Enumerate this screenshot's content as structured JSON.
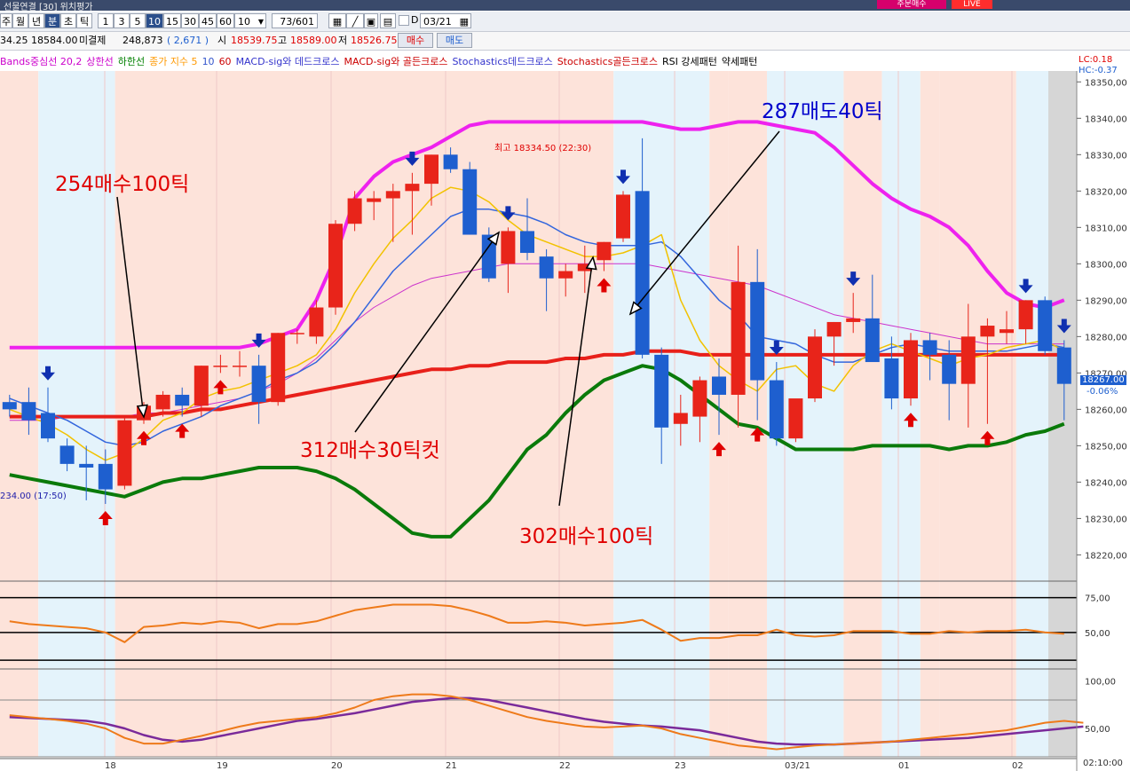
{
  "window": {
    "title_fragment": "선물연결 [30] 위치평가",
    "right_button": "주문매수",
    "live_badge": "LIVE"
  },
  "toolbar": {
    "period_buttons": [
      "주",
      "월",
      "년",
      "분",
      "초",
      "틱"
    ],
    "interval_buttons": [
      "1",
      "3",
      "5",
      "10",
      "15",
      "30",
      "45",
      "60"
    ],
    "selected_interval": "10",
    "count_value": "10",
    "page_indicator": "73/601",
    "d_label": "D",
    "date_value": "03/21"
  },
  "quote": {
    "prev": "34.25",
    "last": "18584.00",
    "open_interest_label": "미결제",
    "open_interest": "248,873",
    "oi_change": "( 2,671 )",
    "open_label": "시",
    "open": "18539.75",
    "high_label": "고",
    "high": "18589.00",
    "low_label": "저",
    "low": "18526.75",
    "buy_button": "매수",
    "sell_button": "매도"
  },
  "legend": [
    {
      "text": "Bands중심선 20,2",
      "color": "#cc00cc"
    },
    {
      "text": "상한선",
      "color": "#cc00cc"
    },
    {
      "text": "하한선",
      "color": "#008000"
    },
    {
      "text": "종가 지수 5",
      "color": "#ff9900"
    },
    {
      "text": "10",
      "color": "#3355cc"
    },
    {
      "text": "60",
      "color": "#cc0000"
    },
    {
      "text": "MACD-sig와 데드크로스",
      "color": "#3333cc"
    },
    {
      "text": "MACD-sig와 골든크로스",
      "color": "#cc0000"
    },
    {
      "text": "Stochastics데드크로스",
      "color": "#3333cc"
    },
    {
      "text": "Stochastics골든크로스",
      "color": "#cc0000"
    },
    {
      "text": "RSI 강세패턴",
      "color": "#000000"
    },
    {
      "text": "약세패턴",
      "color": "#000000"
    }
  ],
  "axis_info": {
    "lc": "LC:0.18",
    "hc": "HC:-0.37",
    "current_price": "18267.00",
    "current_change": "-0.06%",
    "time_end": "02:10:00",
    "high_note": "최고 18334.50 (22:30)",
    "low_note": "234.00 (17:50)"
  },
  "annotations": [
    {
      "text": "254매수100틱",
      "color": "#e00000"
    },
    {
      "text": "287매도40틱",
      "color": "#0000cc"
    },
    {
      "text": "312매수30틱컷",
      "color": "#e00000"
    },
    {
      "text": "302매수100틱",
      "color": "#e00000"
    }
  ],
  "chart_data": [
    {
      "type": "candlestick",
      "title": "",
      "y_ticks": [
        "18350,00",
        "18340,00",
        "18330,00",
        "18320,00",
        "18310,00",
        "18300,00",
        "18290,00",
        "18280,00",
        "18270,00",
        "18260,00",
        "18250,00",
        "18240,00",
        "18230,00",
        "18220,00"
      ],
      "x_labels": [
        "18",
        "19",
        "20",
        "21",
        "22",
        "23",
        "03/21",
        "01",
        "02"
      ],
      "ylim": [
        18214,
        18353
      ],
      "colors": {
        "up": "#e8241a",
        "down": "#1e5fcf",
        "bb_upper": "#ee22ee",
        "bb_lower": "#0a7a0a",
        "ma5": "#f2c200",
        "ma10": "#3366dd",
        "ma60": "#e8201a",
        "bb_mid": "#cc33cc"
      },
      "candles": [
        {
          "o": 18262,
          "h": 18264,
          "l": 18258,
          "c": 18260
        },
        {
          "o": 18262,
          "h": 18266,
          "l": 18253,
          "c": 18257
        },
        {
          "o": 18259,
          "h": 18266,
          "l": 18251,
          "c": 18252
        },
        {
          "o": 18250,
          "h": 18252,
          "l": 18243,
          "c": 18245
        },
        {
          "o": 18245,
          "h": 18250,
          "l": 18235,
          "c": 18244
        },
        {
          "o": 18245,
          "h": 18249,
          "l": 18234,
          "c": 18238
        },
        {
          "o": 18239,
          "h": 18258,
          "l": 18238,
          "c": 18257
        },
        {
          "o": 18257,
          "h": 18262,
          "l": 18256,
          "c": 18261
        },
        {
          "o": 18260,
          "h": 18265,
          "l": 18258,
          "c": 18264
        },
        {
          "o": 18264,
          "h": 18266,
          "l": 18258,
          "c": 18261
        },
        {
          "o": 18261,
          "h": 18272,
          "l": 18258,
          "c": 18272
        },
        {
          "o": 18272,
          "h": 18275,
          "l": 18270,
          "c": 18272
        },
        {
          "o": 18272,
          "h": 18276,
          "l": 18269,
          "c": 18272
        },
        {
          "o": 18272,
          "h": 18275,
          "l": 18256,
          "c": 18262
        },
        {
          "o": 18262,
          "h": 18281,
          "l": 18261,
          "c": 18281
        },
        {
          "o": 18281,
          "h": 18282,
          "l": 18278,
          "c": 18281
        },
        {
          "o": 18280,
          "h": 18290,
          "l": 18278,
          "c": 18288
        },
        {
          "o": 18288,
          "h": 18312,
          "l": 18286,
          "c": 18311
        },
        {
          "o": 18311,
          "h": 18320,
          "l": 18309,
          "c": 18318
        },
        {
          "o": 18317,
          "h": 18320,
          "l": 18312,
          "c": 18318
        },
        {
          "o": 18318,
          "h": 18322,
          "l": 18306,
          "c": 18320
        },
        {
          "o": 18320,
          "h": 18325,
          "l": 18308,
          "c": 18322
        },
        {
          "o": 18322,
          "h": 18330,
          "l": 18316,
          "c": 18330
        },
        {
          "o": 18330,
          "h": 18332,
          "l": 18325,
          "c": 18326
        },
        {
          "o": 18326,
          "h": 18328,
          "l": 18308,
          "c": 18308
        },
        {
          "o": 18308,
          "h": 18310,
          "l": 18295,
          "c": 18296
        },
        {
          "o": 18300,
          "h": 18310,
          "l": 18292,
          "c": 18309
        },
        {
          "o": 18309,
          "h": 18318,
          "l": 18301,
          "c": 18303
        },
        {
          "o": 18302,
          "h": 18304,
          "l": 18287,
          "c": 18296
        },
        {
          "o": 18296,
          "h": 18300,
          "l": 18291,
          "c": 18298
        },
        {
          "o": 18298,
          "h": 18305,
          "l": 18292,
          "c": 18300
        },
        {
          "o": 18301,
          "h": 18306,
          "l": 18298,
          "c": 18306
        },
        {
          "o": 18307,
          "h": 18320,
          "l": 18306,
          "c": 18319
        },
        {
          "o": 18320,
          "h": 18334.5,
          "l": 18274,
          "c": 18275
        },
        {
          "o": 18275,
          "h": 18277,
          "l": 18245,
          "c": 18255
        },
        {
          "o": 18256,
          "h": 18264,
          "l": 18250,
          "c": 18259
        },
        {
          "o": 18258,
          "h": 18269,
          "l": 18251,
          "c": 18268
        },
        {
          "o": 18269,
          "h": 18274,
          "l": 18253,
          "c": 18264
        },
        {
          "o": 18264,
          "h": 18305,
          "l": 18255,
          "c": 18295
        },
        {
          "o": 18295,
          "h": 18304,
          "l": 18257,
          "c": 18268
        },
        {
          "o": 18268,
          "h": 18273,
          "l": 18250,
          "c": 18252
        },
        {
          "o": 18252,
          "h": 18262,
          "l": 18251,
          "c": 18263
        },
        {
          "o": 18263,
          "h": 18282,
          "l": 18262,
          "c": 18280
        },
        {
          "o": 18280,
          "h": 18284,
          "l": 18272,
          "c": 18284
        },
        {
          "o": 18284,
          "h": 18292,
          "l": 18281,
          "c": 18285
        },
        {
          "o": 18285,
          "h": 18297,
          "l": 18275,
          "c": 18273
        },
        {
          "o": 18274,
          "h": 18280,
          "l": 18260,
          "c": 18263
        },
        {
          "o": 18263,
          "h": 18281,
          "l": 18261,
          "c": 18279
        },
        {
          "o": 18279,
          "h": 18281,
          "l": 18268,
          "c": 18275
        },
        {
          "o": 18275,
          "h": 18279,
          "l": 18257,
          "c": 18267
        },
        {
          "o": 18267,
          "h": 18289,
          "l": 18255,
          "c": 18280
        },
        {
          "o": 18280,
          "h": 18285,
          "l": 18256,
          "c": 18283
        },
        {
          "o": 18281,
          "h": 18287,
          "l": 18278,
          "c": 18282
        },
        {
          "o": 18282,
          "h": 18290,
          "l": 18278,
          "c": 18290
        },
        {
          "o": 18290,
          "h": 18291,
          "l": 18275,
          "c": 18276
        },
        {
          "o": 18277,
          "h": 18279,
          "l": 18257,
          "c": 18267
        }
      ],
      "bb_upper": [
        18277,
        18277,
        18277,
        18277,
        18277,
        18277,
        18277,
        18277,
        18277,
        18277,
        18277,
        18277,
        18277,
        18278,
        18280,
        18282,
        18290,
        18302,
        18318,
        18324,
        18328,
        18330,
        18332,
        18335,
        18338,
        18339,
        18339,
        18339,
        18339,
        18339,
        18339,
        18339,
        18339,
        18339,
        18338,
        18337,
        18337,
        18338,
        18339,
        18339,
        18338,
        18337,
        18336,
        18332,
        18327,
        18322,
        18318,
        18315,
        18313,
        18310,
        18305,
        18298,
        18292,
        18289,
        18288,
        18290
      ],
      "bb_lower": [
        18242,
        18241,
        18240,
        18239,
        18238,
        18237,
        18236,
        18238,
        18240,
        18241,
        18241,
        18242,
        18243,
        18244,
        18244,
        18244,
        18243,
        18241,
        18238,
        18234,
        18230,
        18226,
        18225,
        18225,
        18230,
        18235,
        18242,
        18249,
        18253,
        18259,
        18264,
        18268,
        18270,
        18272,
        18271,
        18268,
        18264,
        18260,
        18256,
        18255,
        18252,
        18249,
        18249,
        18249,
        18249,
        18250,
        18250,
        18250,
        18250,
        18249,
        18250,
        18250,
        18251,
        18253,
        18254,
        18256
      ],
      "ma5": [
        18260,
        18258,
        18256,
        18253,
        18249,
        18246,
        18248,
        18252,
        18257,
        18259,
        18263,
        18265,
        18266,
        18268,
        18270,
        18272,
        18275,
        18282,
        18292,
        18300,
        18307,
        18312,
        18318,
        18321,
        18320,
        18317,
        18312,
        18308,
        18306,
        18304,
        18302,
        18302,
        18303,
        18305,
        18308,
        18290,
        18279,
        18272,
        18268,
        18265,
        18271,
        18272,
        18267,
        18265,
        18272,
        18276,
        18278,
        18276,
        18274,
        18272,
        18274,
        18275,
        18277,
        18278,
        18279,
        18276
      ],
      "ma10": [
        18263,
        18261,
        18259,
        18257,
        18254,
        18251,
        18250,
        18251,
        18254,
        18256,
        18258,
        18261,
        18263,
        18265,
        18268,
        18270,
        18273,
        18278,
        18284,
        18291,
        18298,
        18303,
        18308,
        18313,
        18315,
        18315,
        18314,
        18313,
        18311,
        18308,
        18306,
        18305,
        18305,
        18305,
        18306,
        18302,
        18296,
        18290,
        18286,
        18280,
        18279,
        18278,
        18275,
        18273,
        18273,
        18275,
        18277,
        18278,
        18277,
        18276,
        18276,
        18276,
        18276,
        18277,
        18278,
        18277
      ],
      "ma60": [
        18258,
        18258,
        18258,
        18258,
        18258,
        18258,
        18258,
        18258,
        18259,
        18259,
        18260,
        18260,
        18261,
        18262,
        18263,
        18264,
        18265,
        18266,
        18267,
        18268,
        18269,
        18270,
        18271,
        18271,
        18272,
        18272,
        18273,
        18273,
        18273,
        18274,
        18274,
        18275,
        18275,
        18276,
        18276,
        18276,
        18275,
        18275,
        18275,
        18275,
        18275,
        18275,
        18275,
        18275,
        18275,
        18275,
        18275,
        18275,
        18275,
        18275,
        18275,
        18275,
        18275,
        18275,
        18275,
        18275
      ],
      "bb_mid": [
        18257,
        18257,
        18257,
        18258,
        18258,
        18258,
        18258,
        18259,
        18259,
        18260,
        18261,
        18262,
        18263,
        18265,
        18267,
        18270,
        18274,
        18279,
        18284,
        18288,
        18291,
        18294,
        18296,
        18297,
        18298,
        18299,
        18300,
        18300,
        18300,
        18300,
        18300,
        18300,
        18300,
        18300,
        18299,
        18298,
        18297,
        18296,
        18295,
        18294,
        18292,
        18290,
        18288,
        18286,
        18285,
        18284,
        18283,
        18282,
        18281,
        18280,
        18279,
        18278,
        18278,
        18278,
        18278,
        18278
      ],
      "buy_arrows": [
        5,
        7,
        9,
        11,
        31,
        37,
        39,
        47,
        51
      ],
      "sell_arrows": [
        2,
        13,
        21,
        26,
        32,
        40,
        44,
        53,
        55
      ]
    },
    {
      "type": "line",
      "title": "RSI",
      "y_ticks": [
        "75,00",
        "50,00"
      ],
      "ylim": [
        25,
        85
      ],
      "series": [
        {
          "values": [
            58,
            56,
            55,
            54,
            53,
            50,
            43,
            54,
            55,
            57,
            56,
            58,
            57,
            53,
            56,
            56,
            58,
            62,
            66,
            68,
            70,
            70,
            70,
            69,
            66,
            62,
            57,
            57,
            58,
            57,
            55,
            56,
            57,
            59,
            52,
            44,
            46,
            46,
            48,
            48,
            52,
            48,
            47,
            48,
            51,
            51,
            51,
            49,
            49,
            51,
            50,
            51,
            51,
            52,
            50,
            49
          ]
        }
      ]
    },
    {
      "type": "line",
      "title": "Stochastics",
      "y_ticks": [
        "100,00",
        "50,00"
      ],
      "ylim": [
        20,
        110
      ],
      "series": [
        {
          "values": [
            64,
            62,
            60,
            58,
            55,
            50,
            40,
            34,
            34,
            38,
            42,
            47,
            52,
            56,
            58,
            60,
            62,
            66,
            72,
            80,
            84,
            86,
            86,
            84,
            80,
            74,
            68,
            62,
            58,
            55,
            52,
            51,
            52,
            53,
            50,
            44,
            40,
            36,
            32,
            30,
            28,
            30,
            32,
            33,
            34,
            35,
            36,
            38,
            40,
            42,
            44,
            46,
            48,
            52,
            56,
            58,
            56
          ]
        },
        {
          "values": [
            62,
            61,
            60,
            59,
            58,
            55,
            50,
            43,
            38,
            36,
            38,
            42,
            46,
            50,
            54,
            58,
            60,
            63,
            66,
            70,
            74,
            78,
            80,
            82,
            82,
            80,
            76,
            72,
            68,
            64,
            60,
            57,
            55,
            53,
            52,
            50,
            48,
            44,
            40,
            36,
            34,
            33,
            33,
            33,
            34,
            35,
            36,
            37,
            38,
            39,
            40,
            42,
            44,
            46,
            48,
            50,
            52
          ]
        }
      ]
    }
  ]
}
